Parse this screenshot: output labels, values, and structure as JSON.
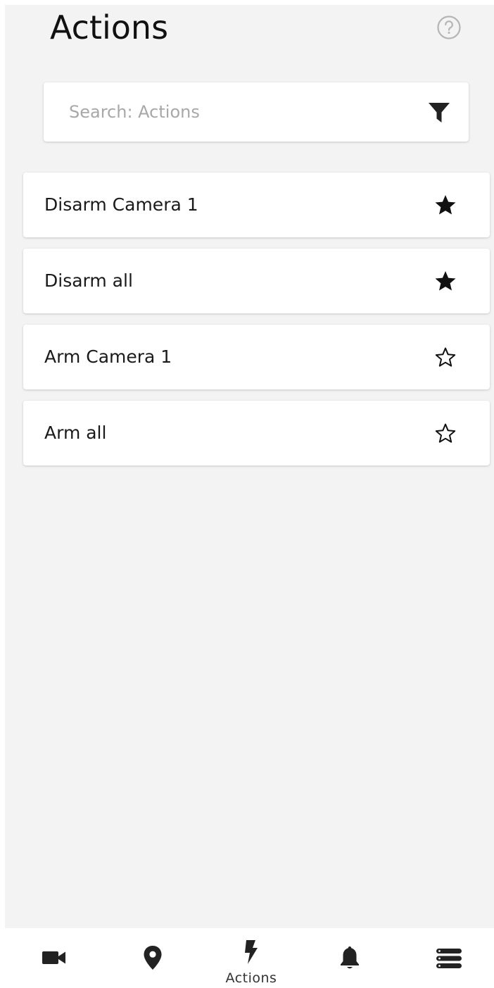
{
  "header": {
    "title": "Actions",
    "help_icon": "question-circle-icon"
  },
  "search": {
    "placeholder": "Search: Actions",
    "value": "",
    "filter_icon": "filter-funnel-icon"
  },
  "actions": [
    {
      "label": "Disarm Camera 1",
      "favorite": true
    },
    {
      "label": "Disarm all",
      "favorite": true
    },
    {
      "label": "Arm Camera 1",
      "favorite": false
    },
    {
      "label": "Arm all",
      "favorite": false
    }
  ],
  "bottom_nav": {
    "active": "actions",
    "items": [
      {
        "id": "cameras",
        "icon": "video-camera-icon",
        "label": ""
      },
      {
        "id": "map",
        "icon": "map-pin-icon",
        "label": ""
      },
      {
        "id": "actions",
        "icon": "lightning-bolt-icon",
        "label": "Actions"
      },
      {
        "id": "events",
        "icon": "bell-icon",
        "label": ""
      },
      {
        "id": "menu",
        "icon": "menu-stack-icon",
        "label": ""
      }
    ]
  },
  "colors": {
    "background": "#f3f3f3",
    "card": "#ffffff",
    "icon_dark": "#222222",
    "icon_muted": "#b5b5b5",
    "placeholder": "#a8a8a8"
  }
}
